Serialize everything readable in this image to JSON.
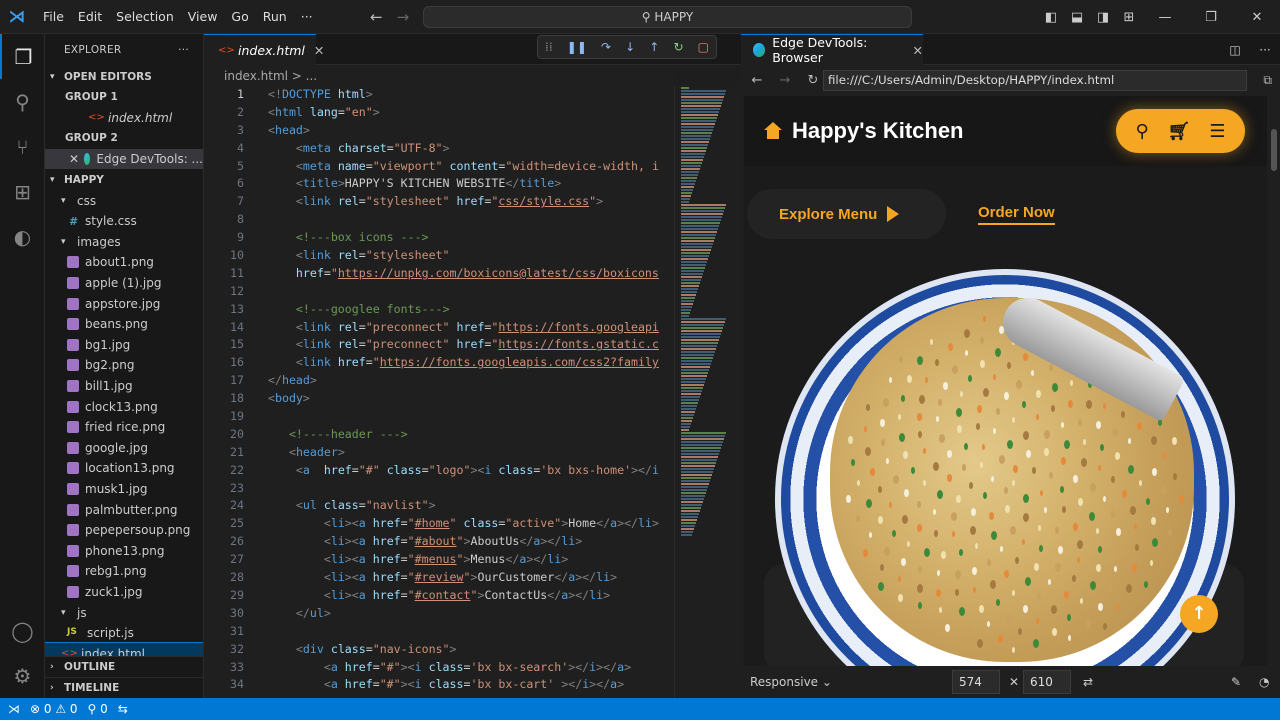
{
  "titlebar": {
    "menu": [
      "File",
      "Edit",
      "Selection",
      "View",
      "Go",
      "Run",
      "···"
    ],
    "search": "HAPPY"
  },
  "sidebar": {
    "title": "EXPLORER",
    "open_editors": "OPEN EDITORS",
    "group1": "GROUP 1",
    "group1_file": "index.html",
    "group2": "GROUP 2",
    "group2_file": "Edge DevTools: ...",
    "root": "HAPPY",
    "css_folder": "css",
    "css_file": "style.css",
    "images_folder": "images",
    "images": [
      "about1.png",
      "apple (1).jpg",
      "appstore.jpg",
      "beans.png",
      "bg1.jpg",
      "bg2.png",
      "bill1.jpg",
      "clock13.png",
      "fried rice.png",
      "google.jpg",
      "location13.png",
      "musk1.jpg",
      "palmbutter.png",
      "pepepersoup.png",
      "phone13.png",
      "rebg1.png",
      "zuck1.jpg"
    ],
    "js_folder": "js",
    "js_file": "script.js",
    "index_file": "index.html",
    "outline": "OUTLINE",
    "timeline": "TIMELINE"
  },
  "editor": {
    "tab": "index.html",
    "breadcrumb": "index.html > ...",
    "lines": [
      {
        "n": "1",
        "h": "<span class='p'>&lt;!</span><span class='t'>DOCTYPE</span> <span class='a'>html</span><span class='p'>&gt;</span>"
      },
      {
        "n": "2",
        "h": "<span class='p'>&lt;</span><span class='t'>html</span> <span class='a'>lang</span>=<span class='s'>\"en\"</span><span class='p'>&gt;</span>"
      },
      {
        "n": "3",
        "h": "<span class='p'>&lt;</span><span class='t'>head</span><span class='p'>&gt;</span>"
      },
      {
        "n": "4",
        "h": "    <span class='p'>&lt;</span><span class='t'>meta</span> <span class='a'>charset</span>=<span class='s'>\"UTF-8\"</span><span class='p'>&gt;</span>"
      },
      {
        "n": "5",
        "h": "    <span class='p'>&lt;</span><span class='t'>meta</span> <span class='a'>name</span>=<span class='s'>\"viewport\"</span> <span class='a'>content</span>=<span class='s'>\"width=device-width, i</span>"
      },
      {
        "n": "6",
        "h": "    <span class='p'>&lt;</span><span class='t'>title</span><span class='p'>&gt;</span>HAPPY'S KITCHEN WEBSITE<span class='p'>&lt;/</span><span class='t'>title</span><span class='p'>&gt;</span>"
      },
      {
        "n": "7",
        "h": "    <span class='p'>&lt;</span><span class='t'>link</span> <span class='a'>rel</span>=<span class='s'>\"stylesheet\"</span> <span class='a'>href</span>=<span class='s'>\"<span class='u'>css/style.css</span>\"</span><span class='p'>&gt;</span>"
      },
      {
        "n": "8",
        "h": ""
      },
      {
        "n": "9",
        "h": "    <span class='c'>&lt;!---box icons ---&gt;</span>"
      },
      {
        "n": "10",
        "h": "    <span class='p'>&lt;</span><span class='t'>link</span> <span class='a'>rel</span>=<span class='s'>\"stylesheet\"</span>"
      },
      {
        "n": "11",
        "h": "    <span class='a'>href</span>=<span class='s'>\"<span class='u'>https://unpkg.com/boxicons@latest/css/boxicons</span></span>"
      },
      {
        "n": "12",
        "h": ""
      },
      {
        "n": "13",
        "h": "    <span class='c'>&lt;!---googlee fonts---&gt;</span>"
      },
      {
        "n": "14",
        "h": "    <span class='p'>&lt;</span><span class='t'>link</span> <span class='a'>rel</span>=<span class='s'>\"preconnect\"</span> <span class='a'>href</span>=<span class='s'>\"<span class='u'>https://fonts.googleapi</span></span>"
      },
      {
        "n": "15",
        "h": "    <span class='p'>&lt;</span><span class='t'>link</span> <span class='a'>rel</span>=<span class='s'>\"preconnect\"</span> <span class='a'>href</span>=<span class='s'>\"<span class='u'>https://fonts.gstatic.c</span></span>"
      },
      {
        "n": "16",
        "h": "    <span class='p'>&lt;</span><span class='t'>link</span> <span class='a'>href</span>=<span class='s'>\"<span class='u'>https://fonts.googleapis.com/css2?family</span></span>"
      },
      {
        "n": "17",
        "h": "<span class='p'>&lt;/</span><span class='t'>head</span><span class='p'>&gt;</span>"
      },
      {
        "n": "18",
        "h": "<span class='p'>&lt;</span><span class='t'>body</span><span class='p'>&gt;</span>"
      },
      {
        "n": "19",
        "h": ""
      },
      {
        "n": "20",
        "h": "   <span class='c'>&lt;!----header ---&gt;</span>"
      },
      {
        "n": "21",
        "h": "   <span class='p'>&lt;</span><span class='t'>header</span><span class='p'>&gt;</span>"
      },
      {
        "n": "22",
        "h": "    <span class='p'>&lt;</span><span class='t'>a</span>  <span class='a'>href</span>=<span class='s'>\"#\"</span> <span class='a'>class</span>=<span class='s'>\"logo\"</span><span class='p'>&gt;&lt;</span><span class='t'>i</span> <span class='a'>class</span>=<span class='s'>'bx bxs-home'</span><span class='p'>&gt;&lt;/</span><span class='t'>i</span>"
      },
      {
        "n": "23",
        "h": ""
      },
      {
        "n": "24",
        "h": "    <span class='p'>&lt;</span><span class='t'>ul</span> <span class='a'>class</span>=<span class='s'>\"navlist\"</span><span class='p'>&gt;</span>"
      },
      {
        "n": "25",
        "h": "        <span class='p'>&lt;</span><span class='t'>li</span><span class='p'>&gt;&lt;</span><span class='t'>a</span> <span class='a'>href</span>=<span class='s'>\"<span class='u'>#home</span>\"</span> <span class='a'>class</span>=<span class='s'>\"active\"</span><span class='p'>&gt;</span>Home<span class='p'>&lt;/</span><span class='t'>a</span><span class='p'>&gt;&lt;/</span><span class='t'>li</span><span class='p'>&gt;</span>"
      },
      {
        "n": "26",
        "h": "        <span class='p'>&lt;</span><span class='t'>li</span><span class='p'>&gt;&lt;</span><span class='t'>a</span> <span class='a'>href</span>=<span class='s'>\"<span class='u'>#about</span>\"</span><span class='p'>&gt;</span>AboutUs<span class='p'>&lt;/</span><span class='t'>a</span><span class='p'>&gt;&lt;/</span><span class='t'>li</span><span class='p'>&gt;</span>"
      },
      {
        "n": "27",
        "h": "        <span class='p'>&lt;</span><span class='t'>li</span><span class='p'>&gt;&lt;</span><span class='t'>a</span> <span class='a'>href</span>=<span class='s'>\"<span class='u'>#menus</span>\"</span><span class='p'>&gt;</span>Menus<span class='p'>&lt;/</span><span class='t'>a</span><span class='p'>&gt;&lt;/</span><span class='t'>li</span><span class='p'>&gt;</span>"
      },
      {
        "n": "28",
        "h": "        <span class='p'>&lt;</span><span class='t'>li</span><span class='p'>&gt;&lt;</span><span class='t'>a</span> <span class='a'>href</span>=<span class='s'>\"<span class='u'>#review</span>\"</span><span class='p'>&gt;</span>OurCustomer<span class='p'>&lt;/</span><span class='t'>a</span><span class='p'>&gt;&lt;/</span><span class='t'>li</span><span class='p'>&gt;</span>"
      },
      {
        "n": "29",
        "h": "        <span class='p'>&lt;</span><span class='t'>li</span><span class='p'>&gt;&lt;</span><span class='t'>a</span> <span class='a'>href</span>=<span class='s'>\"<span class='u'>#contact</span>\"</span><span class='p'>&gt;</span>ContactUs<span class='p'>&lt;/</span><span class='t'>a</span><span class='p'>&gt;&lt;/</span><span class='t'>li</span><span class='p'>&gt;</span>"
      },
      {
        "n": "30",
        "h": "    <span class='p'>&lt;/</span><span class='t'>ul</span><span class='p'>&gt;</span>"
      },
      {
        "n": "31",
        "h": ""
      },
      {
        "n": "32",
        "h": "    <span class='p'>&lt;</span><span class='t'>div</span> <span class='a'>class</span>=<span class='s'>\"nav-icons\"</span><span class='p'>&gt;</span>"
      },
      {
        "n": "33",
        "h": "        <span class='p'>&lt;</span><span class='t'>a</span> <span class='a'>href</span>=<span class='s'>\"#\"</span><span class='p'>&gt;&lt;</span><span class='t'>i</span> <span class='a'>class</span>=<span class='s'>'bx bx-search'</span><span class='p'>&gt;&lt;/</span><span class='t'>i</span><span class='p'>&gt;&lt;/</span><span class='t'>a</span><span class='p'>&gt;</span>"
      },
      {
        "n": "34",
        "h": "        <span class='p'>&lt;</span><span class='t'>a</span> <span class='a'>href</span>=<span class='s'>\"#\"</span><span class='p'>&gt;&lt;</span><span class='t'>i</span> <span class='a'>class</span>=<span class='s'>'bx bx-cart'</span> <span class='p'>&gt;&lt;/</span><span class='t'>i</span><span class='p'>&gt;&lt;/</span><span class='t'>a</span><span class='p'>&gt;</span>"
      }
    ]
  },
  "browser": {
    "tab": "Edge DevTools: Browser",
    "url": "file:///C:/Users/Admin/Desktop/HAPPY/index.html",
    "site": {
      "logo": "Happy's Kitchen",
      "explore": "Explore Menu",
      "order": "Order Now"
    },
    "responsive": "Responsive",
    "width": "574",
    "times": "✕",
    "height": "610"
  },
  "status": {
    "remote": "⚡",
    "problems": "⊗ 0 ⚠ 0",
    "ports": "⚲ 0"
  },
  "colors": {
    "accent": "#0078d4",
    "brand": "#f5a623"
  }
}
